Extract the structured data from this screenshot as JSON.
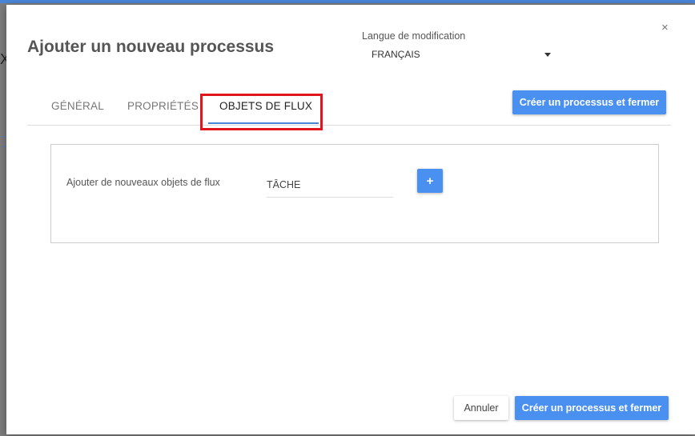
{
  "dialog": {
    "title": "Ajouter un nouveau processus",
    "close_label": "×"
  },
  "language": {
    "label": "Langue de modification",
    "selected": "FRANÇAIS"
  },
  "tabs": [
    {
      "label": "GÉNÉRAL",
      "active": false
    },
    {
      "label": "PROPRIÉTÉS",
      "active": false
    },
    {
      "label": "OBJETS DE FLUX",
      "active": true
    }
  ],
  "actions": {
    "create_close_label": "Créer un processus et fermer",
    "cancel_label": "Annuler"
  },
  "flow_objects": {
    "label": "Ajouter de nouveaux objets de flux",
    "input_value": "TÂCHE",
    "add_label": "+"
  },
  "background": {
    "close_glyph": "X"
  },
  "colors": {
    "accent": "#4a90f0",
    "highlight": "#e0161f",
    "backdrop": "#7d7d7d"
  }
}
